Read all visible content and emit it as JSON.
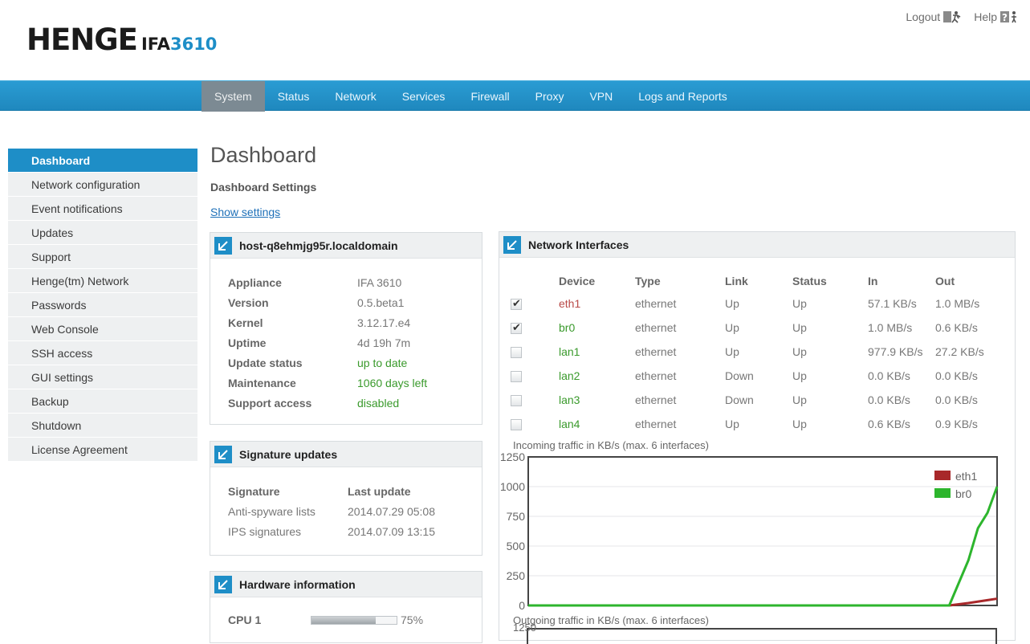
{
  "header": {
    "brand": "HENGE",
    "model_prefix": "IFA",
    "model_suffix": "3610",
    "logout_label": "Logout",
    "help_label": "Help"
  },
  "nav": {
    "items": [
      {
        "label": "System",
        "active": true
      },
      {
        "label": "Status"
      },
      {
        "label": "Network"
      },
      {
        "label": "Services"
      },
      {
        "label": "Firewall"
      },
      {
        "label": "Proxy"
      },
      {
        "label": "VPN"
      },
      {
        "label": "Logs and Reports"
      }
    ]
  },
  "sidebar": {
    "items": [
      {
        "label": "Dashboard",
        "active": true
      },
      {
        "label": "Network configuration"
      },
      {
        "label": "Event notifications"
      },
      {
        "label": "Updates"
      },
      {
        "label": "Support"
      },
      {
        "label": "Henge(tm) Network"
      },
      {
        "label": "Passwords"
      },
      {
        "label": "Web Console"
      },
      {
        "label": "SSH access"
      },
      {
        "label": "GUI settings"
      },
      {
        "label": "Backup"
      },
      {
        "label": "Shutdown"
      },
      {
        "label": "License Agreement"
      }
    ]
  },
  "main": {
    "title": "Dashboard",
    "settings_title": "Dashboard Settings",
    "settings_link": "Show settings"
  },
  "host_panel": {
    "title": "host-q8ehmjg95r.localdomain",
    "rows": [
      {
        "key": "Appliance",
        "value": "IFA 3610"
      },
      {
        "key": "Version",
        "value": "0.5.beta1"
      },
      {
        "key": "Kernel",
        "value": "3.12.17.e4"
      },
      {
        "key": "Uptime",
        "value": "4d 19h 7m"
      },
      {
        "key": "Update status",
        "value": "up to date",
        "status": "green"
      },
      {
        "key": "Maintenance",
        "value": "1060 days left",
        "status": "green"
      },
      {
        "key": "Support access",
        "value": "disabled",
        "status": "green"
      }
    ]
  },
  "signature_panel": {
    "title": "Signature updates",
    "headers": [
      "Signature",
      "Last update"
    ],
    "rows": [
      {
        "name": "Anti-spyware lists",
        "date": "2014.07.29 05:08"
      },
      {
        "name": "IPS signatures",
        "date": "2014.07.09 13:15"
      }
    ]
  },
  "hardware_panel": {
    "title": "Hardware information",
    "cpu_label": "CPU 1",
    "cpu_value": "75%",
    "cpu_fraction": 0.75
  },
  "network_panel": {
    "title": "Network Interfaces",
    "headers": [
      "Device",
      "Type",
      "Link",
      "Status",
      "In",
      "Out"
    ],
    "rows": [
      {
        "checked": true,
        "device": "eth1",
        "color": "red",
        "type": "ethernet",
        "link": "Up",
        "status": "Up",
        "in": "57.1 KB/s",
        "out": "1.0 MB/s"
      },
      {
        "checked": true,
        "device": "br0",
        "color": "green",
        "type": "ethernet",
        "link": "Up",
        "status": "Up",
        "in": "1.0 MB/s",
        "out": "0.6 KB/s"
      },
      {
        "checked": false,
        "device": "lan1",
        "color": "green",
        "type": "ethernet",
        "link": "Up",
        "status": "Up",
        "in": "977.9 KB/s",
        "out": "27.2 KB/s"
      },
      {
        "checked": false,
        "device": "lan2",
        "color": "green",
        "type": "ethernet",
        "link": "Down",
        "status": "Up",
        "in": "0.0 KB/s",
        "out": "0.0 KB/s"
      },
      {
        "checked": false,
        "device": "lan3",
        "color": "green",
        "type": "ethernet",
        "link": "Down",
        "status": "Up",
        "in": "0.0 KB/s",
        "out": "0.0 KB/s"
      },
      {
        "checked": false,
        "device": "lan4",
        "color": "green",
        "type": "ethernet",
        "link": "Up",
        "status": "Up",
        "in": "0.6 KB/s",
        "out": "0.9 KB/s"
      }
    ],
    "incoming_title": "Incoming traffic in KB/s (max. 6 interfaces)",
    "outgoing_title": "Outgoing traffic in KB/s (max. 6 interfaces)",
    "outgoing_top_tick": "1250"
  },
  "chart_data": {
    "type": "line",
    "title": "Incoming traffic in KB/s (max. 6 interfaces)",
    "ylim": [
      0,
      1250
    ],
    "yticks": [
      0,
      250,
      500,
      750,
      1000,
      1250
    ],
    "grid": true,
    "legend_position": "top-right",
    "x_points": 50,
    "series": [
      {
        "name": "eth1",
        "color": "#a8282a",
        "points": [
          [
            0,
            0
          ],
          [
            42,
            0
          ],
          [
            44,
            0
          ],
          [
            46,
            20
          ],
          [
            48,
            45
          ],
          [
            49,
            57
          ]
        ]
      },
      {
        "name": "br0",
        "color": "#2db52d",
        "points": [
          [
            0,
            0
          ],
          [
            42,
            0
          ],
          [
            44,
            0
          ],
          [
            46,
            380
          ],
          [
            47,
            650
          ],
          [
            48,
            780
          ],
          [
            49,
            1000
          ]
        ]
      }
    ]
  },
  "colors": {
    "accent": "#1e8ec7",
    "nav_active": "#7c8a93",
    "ok_green": "#3a9a2c",
    "device_red": "#b94a48"
  }
}
